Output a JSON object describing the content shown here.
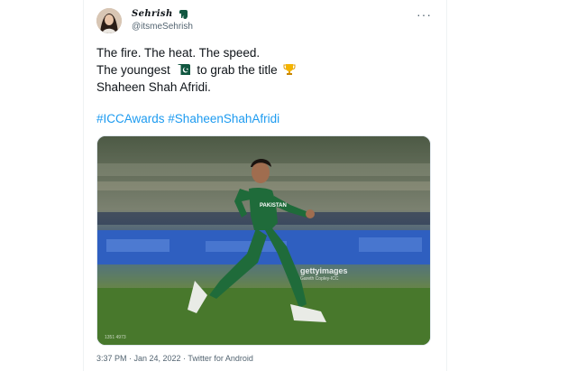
{
  "author": {
    "name": "Sehrish",
    "handle": "@itsmeSehrish"
  },
  "tweet": {
    "line1": "The fire. The heat. The speed.",
    "line2_before": "The youngest",
    "line2_after": "to grab the title",
    "line3": "Shaheen Shah Afridi.",
    "hashtag1": "#ICCAwards",
    "hashtag2": "#ShaheenShahAfridi"
  },
  "media": {
    "watermark": "gettyimages",
    "credit": "Gareth Copley-ICC",
    "ref": "1351 4973",
    "jersey_text": "PAKISTAN"
  },
  "footer": {
    "timestamp": "3:37 PM · Jan 24, 2022 · Twitter for Android"
  },
  "icons": [
    "avatar",
    "pakistan-flag-icon",
    "more-options-icon",
    "trophy-icon"
  ],
  "colors": {
    "link": "#1d9bf0",
    "text": "#0f1419",
    "secondary": "#536471",
    "jersey_green": "#1f6b3a"
  }
}
